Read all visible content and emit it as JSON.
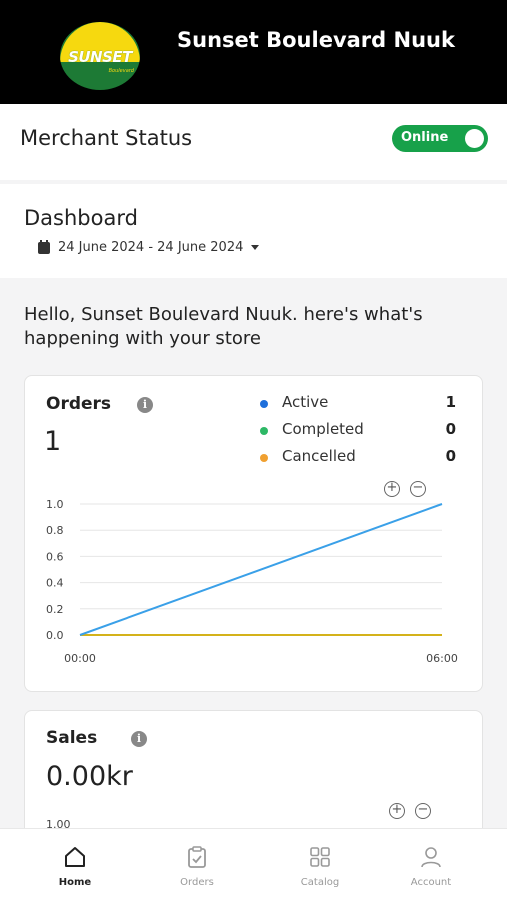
{
  "header": {
    "store_name": "Sunset Boulevard Nuuk",
    "logo_text": "SUNSET",
    "logo_subtext": "Boulevard"
  },
  "merchant_status": {
    "label": "Merchant Status",
    "toggle_label": "Online",
    "toggle_on": true,
    "toggle_color": "#17a14a"
  },
  "dashboard": {
    "title": "Dashboard",
    "date_range": "24 June 2024 - 24 June 2024"
  },
  "greeting": "Hello, Sunset Boulevard Nuuk. here's what's happening with your store",
  "orders_card": {
    "title": "Orders",
    "info_icon": "i",
    "total": "1",
    "legend": [
      {
        "name": "Active",
        "value": "1",
        "color": "#1e6fdb"
      },
      {
        "name": "Completed",
        "value": "0",
        "color": "#2db866"
      },
      {
        "name": "Cancelled",
        "value": "0",
        "color": "#f0a030"
      }
    ],
    "zoom_in": "+",
    "zoom_out": "−"
  },
  "chart_data": {
    "type": "line",
    "x": [
      "00:00",
      "06:00"
    ],
    "series": [
      {
        "name": "Active",
        "values": [
          0,
          1
        ],
        "color": "#3aa0e8"
      },
      {
        "name": "Completed",
        "values": [
          0,
          0
        ],
        "color": "#2db866"
      },
      {
        "name": "Cancelled",
        "values": [
          0,
          0
        ],
        "color": "#d4b21a"
      }
    ],
    "yticks": [
      "1.0",
      "0.8",
      "0.6",
      "0.4",
      "0.2",
      "0.0"
    ],
    "xticks": [
      "00:00",
      "06:00"
    ],
    "ylim": [
      0,
      1
    ],
    "grid": true
  },
  "sales_card": {
    "title": "Sales",
    "info_icon": "i",
    "total": "0.00kr",
    "first_tick": "1.00",
    "zoom_in": "+",
    "zoom_out": "−"
  },
  "bottom_nav": [
    {
      "label": "Home",
      "icon": "home-icon",
      "active": true
    },
    {
      "label": "Orders",
      "icon": "orders-clipboard-icon",
      "active": false
    },
    {
      "label": "Catalog",
      "icon": "catalog-grid-icon",
      "active": false
    },
    {
      "label": "Account",
      "icon": "account-person-icon",
      "active": false
    }
  ]
}
